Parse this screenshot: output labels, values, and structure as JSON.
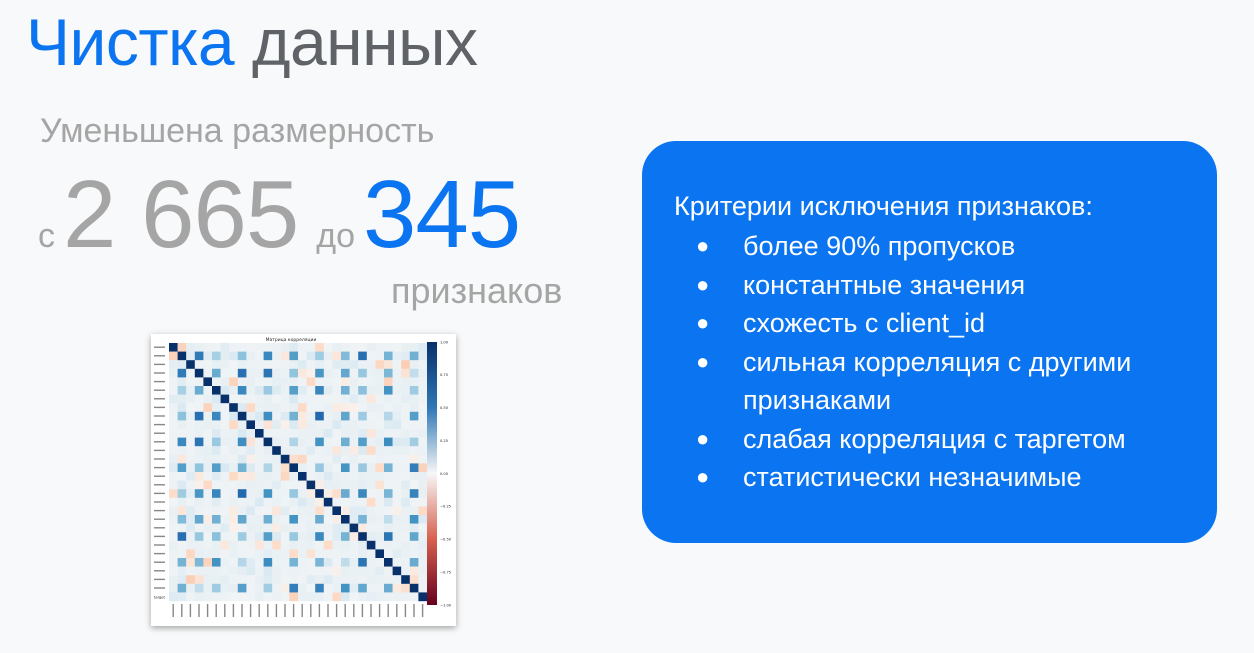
{
  "title": {
    "accent": "Чистка",
    "rest": " данных"
  },
  "subtitle": "Уменьшена размерность",
  "reduction": {
    "from_word": "с",
    "from_value": "2 665",
    "to_word": "до",
    "to_value": "345",
    "unit": "признаков"
  },
  "heatmap": {
    "title": "Матрица корреляции",
    "colorbar_ticks": [
      "1.00",
      "0.75",
      "0.50",
      "0.25",
      "0.00",
      "−0.25",
      "−0.50",
      "−0.75",
      "−1.00"
    ],
    "last_row_label": "target",
    "colors": {
      "positive": "#08306b",
      "neutral": "#f7f7f7",
      "negative": "#67001f"
    }
  },
  "criteria": {
    "heading": "Критерии исключения признаков:",
    "bullet_symbol": "●",
    "items": [
      "более 90% пропусков",
      "константные значения",
      "схожесть с client_id",
      "сильная корреляция с другими признаками",
      "слабая корреляция с таргетом",
      "статистически незначимые"
    ]
  },
  "colors": {
    "accent": "#0b74f0",
    "muted": "#a5a5a5",
    "title_gray": "#5f6368",
    "background": "#f8f9fa"
  }
}
